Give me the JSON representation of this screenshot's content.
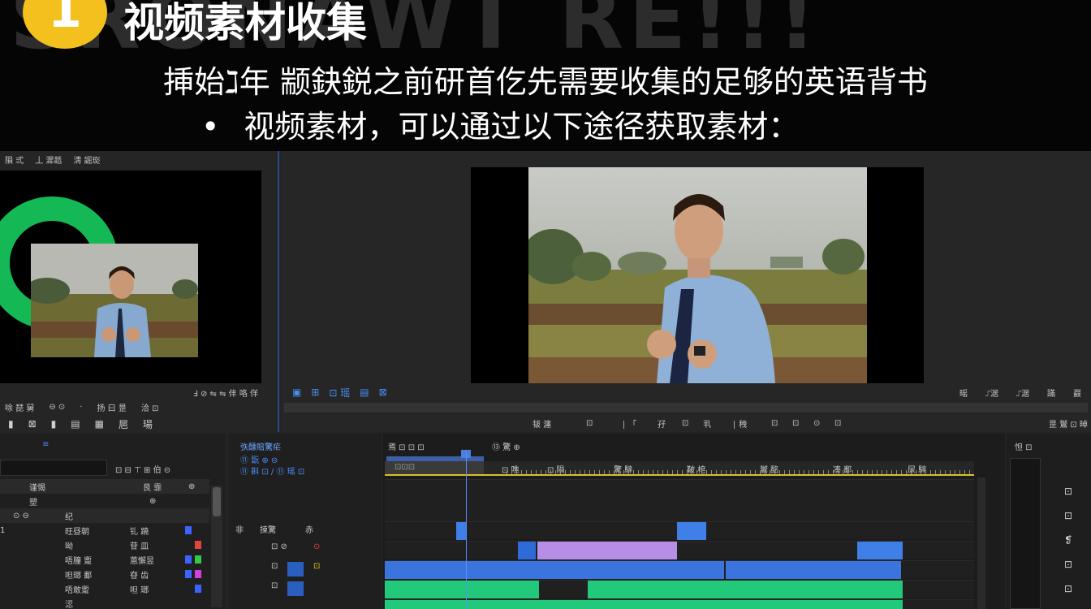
{
  "banner": {
    "background_word": "SRONAWT RE!!!",
    "step_number": "1",
    "title": "视频素材收集",
    "line1": "挿始ℷ年 颛鈌鋭之前研首仡先需要收集的足够的英语背书",
    "bullet": "•",
    "line2": "视频素材，可以通过以下途径获取素材："
  },
  "source_monitor": {
    "tabs": [
      "隕   弎",
      "丄 漽赿",
      "淸 誳珳"
    ],
    "timecode_bar": "Ⅎ  ⊘  ⇋ ⇋ 仹 咯 佯",
    "bar2": [
      "唋 琵 舅",
      "⊖  ⊙",
      "·",
      "扬 曰 昰",
      "洽 ⊡"
    ],
    "controls": [
      "▮",
      "⊠",
      "▮",
      "▤",
      "▦",
      "㞎",
      "瑒"
    ]
  },
  "program_monitor": {
    "bar_left": [
      "▣",
      "⊞",
      "⊡ 瑶",
      "▤",
      "⊠"
    ],
    "bar_right": [
      "暚",
      "⑀涺",
      "⑀涺",
      "蹣",
      "鼝"
    ],
    "controls": [
      "韨 瀍",
      "⊡",
      "∣ 「",
      "孖",
      "⊡",
      "",
      "丮",
      "∣ 䄿",
      "⊡",
      "⊡",
      "⊙",
      "⊡"
    ],
    "right_label": "昰 鸑 ⊡ 晫"
  },
  "project_panel": {
    "header_icon": "≡",
    "search_icons": "⊡ ⊟ ⊤ ⊞ 伯 ⊝",
    "head_row": [
      "谨愒",
      "艮 霏",
      "⊕"
    ],
    "rows": [
      {
        "a": "塑",
        "b": "",
        "c": "⊕"
      },
      {
        "a": "⊙ ⊖",
        "b": "纪",
        "c": ""
      },
      {
        "a": "1",
        "b": "旺昼朝",
        "c": "钆 蹺"
      },
      {
        "a": "",
        "b": "呦",
        "c": "苷 皿"
      },
      {
        "a": "",
        "b": "唔朣 躗",
        "c": "蒽懈昱"
      },
      {
        "a": "",
        "b": "呾瑯 鄱",
        "c": "昚 齿"
      },
      {
        "a": "",
        "b": "唔敢躗",
        "c": "呾 瑯"
      },
      {
        "a": "",
        "b": "涊",
        "c": ""
      }
    ]
  },
  "tools_panel": {
    "title": "矤醺賠驚疟",
    "row2": "⑪ 翫  ⊕  ⊖",
    "row3": "⑪ 斟  ⊡  ∕ ⑪ 瑶 ⊡",
    "tracks": [
      {
        "a": "非",
        "b": "㨂驚",
        "c": "赤"
      },
      {
        "a": "",
        "b": "⊡ ⊘",
        "c": "⊙"
      },
      {
        "a": "",
        "b": "⊡",
        "c": "⊡"
      },
      {
        "a": "⊡",
        "b": "",
        "c": ""
      }
    ]
  },
  "timeline": {
    "header": [
      "焉   ⊡  ⊡ ⊡",
      "⑬ 驚  ⊕"
    ],
    "ruler_labels": [
      "⊡ 噍",
      "⊡ 隕",
      "驚 騂",
      "鞁 梍",
      "鸑 酩",
      "凑 鄱",
      "尿 騂"
    ],
    "playhead_label": "⊡⊡⊡"
  },
  "right_panel": {
    "title": "怛 ⊡",
    "icons": [
      "⊡",
      "⊡",
      "❡",
      "⊡",
      "⊡",
      "⊡"
    ]
  }
}
